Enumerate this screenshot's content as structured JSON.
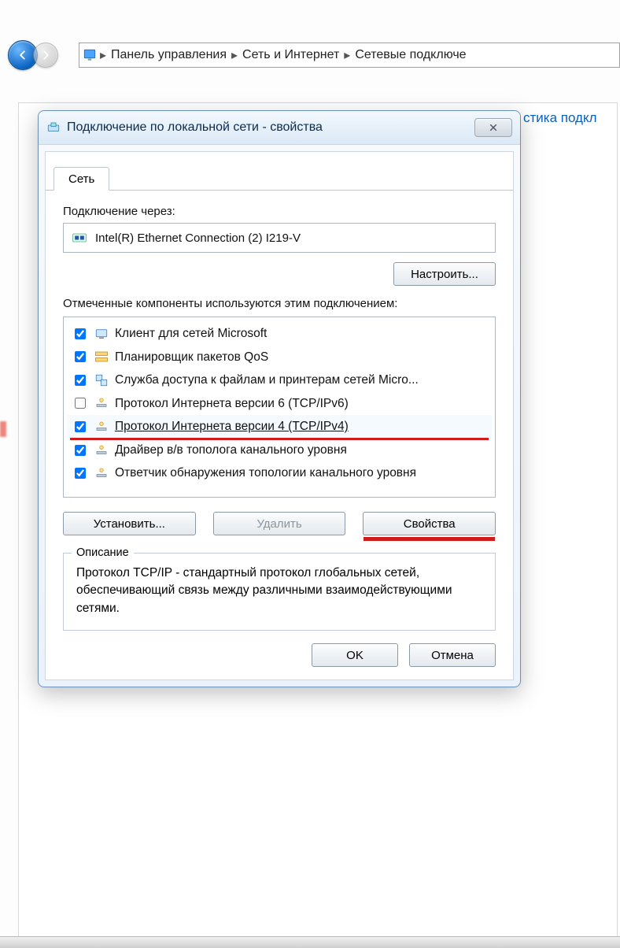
{
  "breadcrumb": {
    "items": [
      "Панель управления",
      "Сеть и Интернет",
      "Сетевые подключе"
    ]
  },
  "background": {
    "diagnostic_link": "стика подкл"
  },
  "dialog": {
    "title": "Подключение по локальной сети - свойства",
    "tab_network": "Сеть",
    "connect_via_label": "Подключение через:",
    "adapter_name": "Intel(R) Ethernet Connection (2) I219-V",
    "configure_btn": "Настроить...",
    "components_label": "Отмеченные компоненты используются этим подключением:",
    "components": [
      {
        "checked": true,
        "label": "Клиент для сетей Microsoft",
        "icon": "client"
      },
      {
        "checked": true,
        "label": "Планировщик пакетов QoS",
        "icon": "qos"
      },
      {
        "checked": true,
        "label": "Служба доступа к файлам и принтерам сетей Micro...",
        "icon": "share"
      },
      {
        "checked": false,
        "label": "Протокол Интернета версии 6 (TCP/IPv6)",
        "icon": "proto"
      },
      {
        "checked": true,
        "label": "Протокол Интернета версии 4 (TCP/IPv4)",
        "icon": "proto",
        "selected": true,
        "redline": true
      },
      {
        "checked": true,
        "label": "Драйвер в/в тополога канального уровня",
        "icon": "proto"
      },
      {
        "checked": true,
        "label": "Ответчик обнаружения топологии канального уровня",
        "icon": "proto"
      }
    ],
    "install_btn": "Установить...",
    "remove_btn": "Удалить",
    "properties_btn": "Свойства",
    "description_legend": "Описание",
    "description_text": "Протокол TCP/IP - стандартный протокол глобальных сетей, обеспечивающий связь между различными взаимодействующими сетями.",
    "ok_btn": "OK",
    "cancel_btn": "Отмена"
  }
}
